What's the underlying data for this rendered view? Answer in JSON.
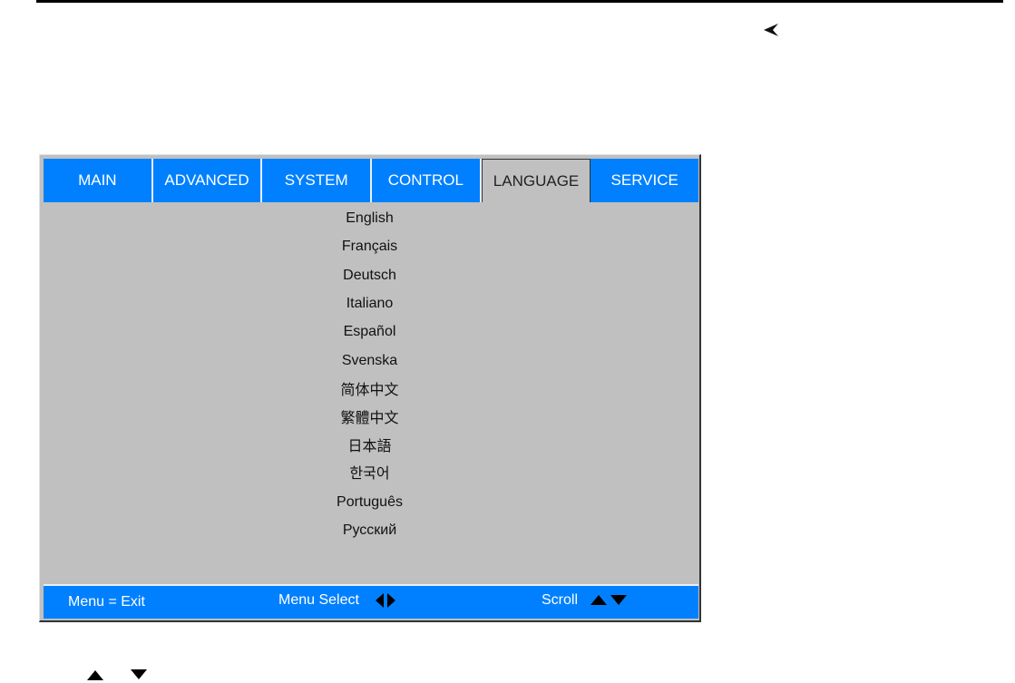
{
  "tabs": [
    {
      "label": "MAIN",
      "active": false
    },
    {
      "label": "ADVANCED",
      "active": false
    },
    {
      "label": "SYSTEM",
      "active": false
    },
    {
      "label": "CONTROL",
      "active": false
    },
    {
      "label": "LANGUAGE",
      "active": true
    },
    {
      "label": "SERVICE",
      "active": false
    }
  ],
  "languages": [
    "English",
    "Français",
    "Deutsch",
    "Italiano",
    "Español",
    "Svenska",
    "简体中文",
    "繁體中文",
    "日本語",
    "한국어",
    "Português",
    "Русский"
  ],
  "footer": {
    "exit": "Menu = Exit",
    "select": "Menu Select",
    "scroll": "Scroll"
  },
  "colors": {
    "accent": "#0080ff",
    "panel": "#c0c0c0"
  },
  "icons": {
    "back": "arrowhead-left-icon",
    "up": "triangle-up-icon",
    "down": "triangle-down-icon"
  }
}
